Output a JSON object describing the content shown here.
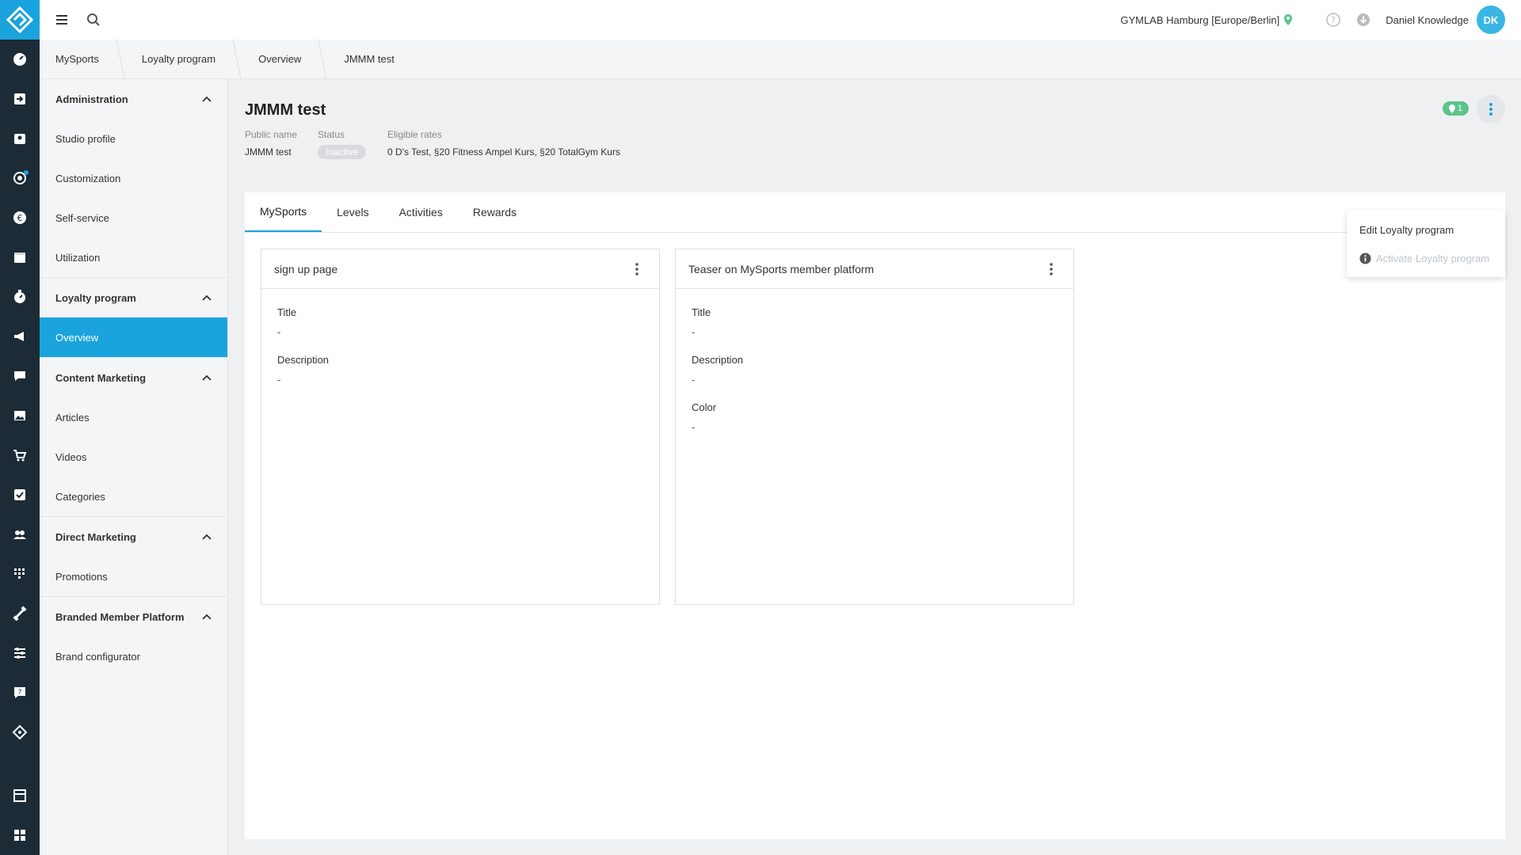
{
  "topbar": {
    "studio": "GYMLAB Hamburg [Europe/Berlin]",
    "user_name": "Daniel Knowledge",
    "avatar_initials": "DK"
  },
  "breadcrumb": [
    "MySports",
    "Loyalty program",
    "Overview",
    "JMMM test"
  ],
  "sidebar": {
    "administration": {
      "label": "Administration",
      "items": [
        "Studio profile",
        "Customization",
        "Self-service",
        "Utilization"
      ]
    },
    "loyalty": {
      "label": "Loyalty program",
      "items": [
        "Overview"
      ]
    },
    "content_marketing": {
      "label": "Content Marketing",
      "items": [
        "Articles",
        "Videos",
        "Categories"
      ]
    },
    "direct_marketing": {
      "label": "Direct Marketing",
      "items": [
        "Promotions"
      ]
    },
    "branded": {
      "label": "Branded Member Platform",
      "items": [
        "Brand configurator"
      ]
    }
  },
  "page": {
    "title": "JMMM test",
    "public_name_label": "Public name",
    "public_name": "JMMM test",
    "status_label": "Status",
    "status": "Inactive",
    "rates_label": "Eligible rates",
    "rates": "0 D's Test, §20 Fitness Ampel Kurs, §20 TotalGym Kurs",
    "location_count": "1"
  },
  "dropdown": {
    "edit": "Edit Loyalty program",
    "activate": "Activate Loyalty program"
  },
  "tabs": [
    "MySports",
    "Levels",
    "Activities",
    "Rewards"
  ],
  "cards": {
    "signup": {
      "title": "sign up page",
      "fields": [
        {
          "label": "Title",
          "value": "-"
        },
        {
          "label": "Description",
          "value": "-"
        }
      ]
    },
    "teaser": {
      "title": "Teaser on MySports member platform",
      "fields": [
        {
          "label": "Title",
          "value": "-"
        },
        {
          "label": "Description",
          "value": "-"
        },
        {
          "label": "Color",
          "value": "-"
        }
      ]
    }
  },
  "colors": {
    "accent": "#1aa3dd",
    "rail": "#1c2b36",
    "badge": "#5bc48a"
  }
}
